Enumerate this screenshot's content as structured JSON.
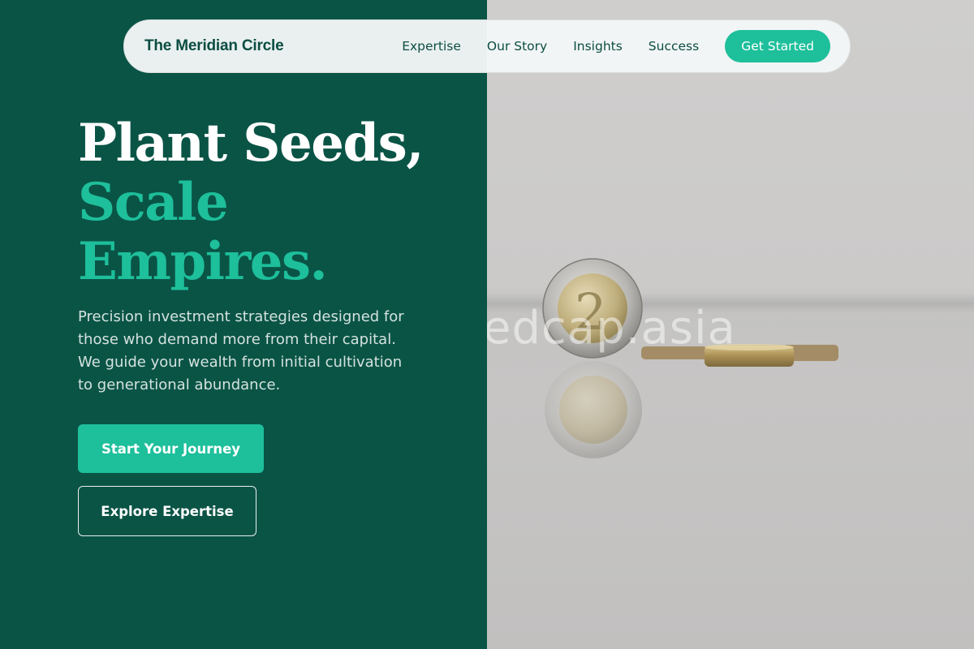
{
  "nav": {
    "brand": "The Meridian Circle",
    "links": [
      "Expertise",
      "Our Story",
      "Insights",
      "Success"
    ],
    "cta": "Get Started"
  },
  "hero": {
    "headline_line1": "Plant Seeds,",
    "headline_line2": "Scale",
    "headline_line3": "Empires.",
    "description": "Precision investment strategies designed for those who demand more from their capital. We guide your wealth from initial cultivation to generational abundance.",
    "primary_button": "Start Your Journey",
    "secondary_button": "Explore Expertise"
  },
  "image": {
    "watermark": "edcap.asia",
    "coin_numeral": "2"
  },
  "colors": {
    "panel_bg": "#0a5446",
    "accent": "#1ebf9b",
    "nav_text": "#0b4d42"
  }
}
